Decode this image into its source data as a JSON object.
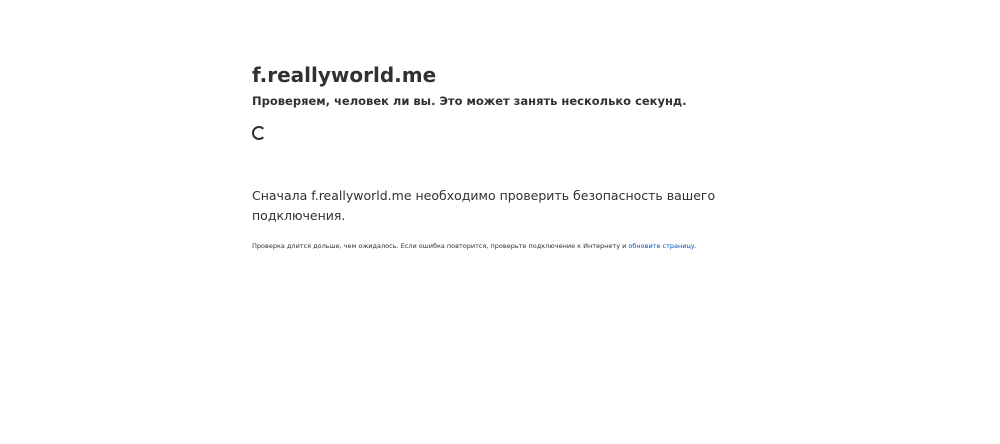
{
  "header": {
    "site_name": "f.reallyworld.me",
    "subtitle": "Проверяем, человек ли вы. Это может занять несколько секунд."
  },
  "spinner": {
    "icon": "loading-spinner-icon"
  },
  "main": {
    "message": "Сначала f.reallyworld.me необходимо проверить безопасность вашего подключения."
  },
  "footnote": {
    "text": "Проверка длится дольше, чем ожидалось. Если ошибка повторится, проверьте подключение к Интернету и ",
    "refresh_link": "обновите страницу",
    "end": "."
  },
  "colors": {
    "text": "#313131",
    "link": "#0051c3",
    "background": "#ffffff"
  }
}
